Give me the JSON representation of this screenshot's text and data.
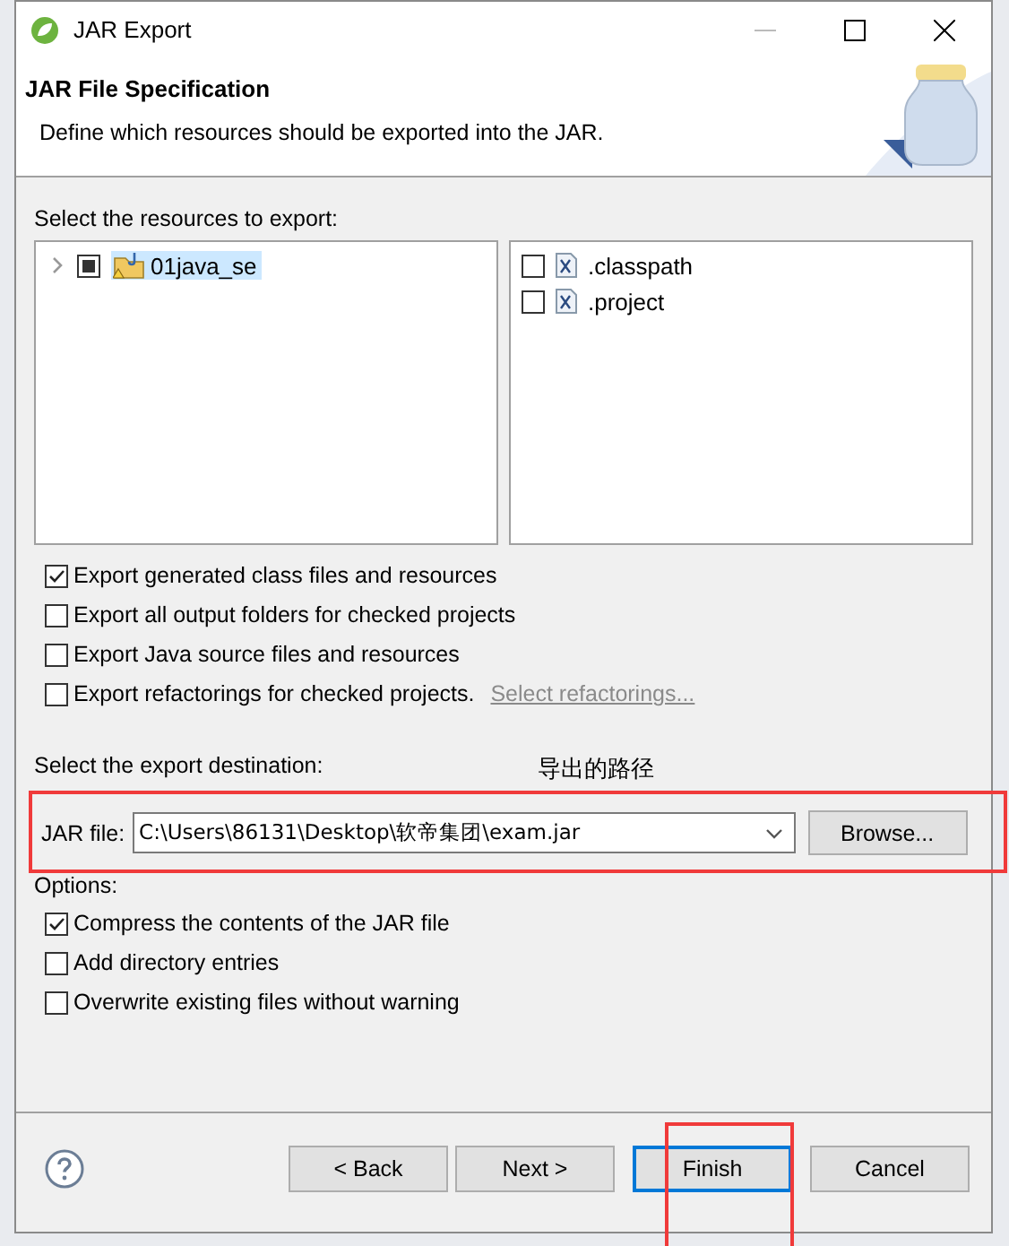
{
  "window": {
    "title": "JAR Export"
  },
  "header": {
    "title": "JAR File Specification",
    "description": "Define which resources should be exported into the JAR."
  },
  "resources": {
    "label": "Select the resources to export:",
    "tree": [
      {
        "label": "01java_se",
        "expanded": false,
        "checked": false,
        "partial": true,
        "selected": true
      }
    ],
    "files": [
      {
        "label": ".classpath",
        "checked": false
      },
      {
        "label": ".project",
        "checked": false
      }
    ]
  },
  "export_options": [
    {
      "label": "Export generated class files and resources",
      "checked": true
    },
    {
      "label": "Export all output folders for checked projects",
      "checked": false
    },
    {
      "label": "Export Java source files and resources",
      "checked": false
    },
    {
      "label": "Export refactorings for checked projects.",
      "checked": false,
      "link": "Select refactorings..."
    }
  ],
  "destination": {
    "label": "Select the export destination:",
    "annotation": "导出的路径",
    "field_label": "JAR file:",
    "value": "C:\\Users\\86131\\Desktop\\软帝集团\\exam.jar",
    "browse": "Browse..."
  },
  "options": {
    "label": "Options:",
    "items": [
      {
        "label": "Compress the contents of the JAR file",
        "checked": true
      },
      {
        "label": "Add directory entries",
        "checked": false
      },
      {
        "label": "Overwrite existing files without warning",
        "checked": false
      }
    ]
  },
  "buttons": [
    {
      "label": "< Back",
      "default": false
    },
    {
      "label": "Next >",
      "default": false
    },
    {
      "label": "Finish",
      "default": true
    },
    {
      "label": "Cancel",
      "default": false
    }
  ]
}
